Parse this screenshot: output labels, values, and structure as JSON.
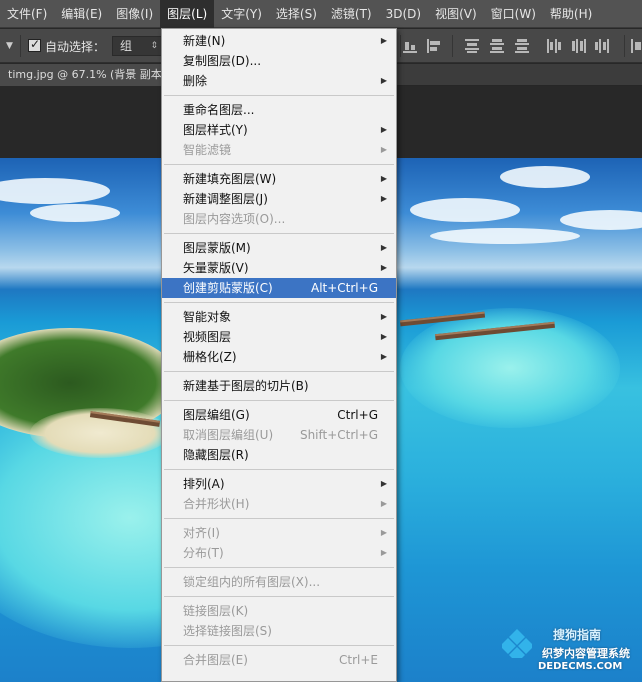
{
  "menubar": {
    "items": [
      "文件(F)",
      "编辑(E)",
      "图像(I)",
      "图层(L)",
      "文字(Y)",
      "选择(S)",
      "滤镜(T)",
      "3D(D)",
      "视图(V)",
      "窗口(W)",
      "帮助(H)"
    ],
    "active": "图层(L)"
  },
  "options": {
    "auto_select_label": "自动选择：",
    "auto_select_checked": true,
    "group_value": "组"
  },
  "document": {
    "tab_title": "timg.jpg @ 67.1% (背景 副本"
  },
  "layer_menu": {
    "items": [
      {
        "label": "新建(N)",
        "submenu": true
      },
      {
        "label": "复制图层(D)..."
      },
      {
        "label": "删除",
        "submenu": true
      },
      {
        "label": "重命名图层..."
      },
      {
        "label": "图层样式(Y)",
        "submenu": true
      },
      {
        "label": "智能滤镜",
        "submenu": true,
        "disabled": true
      },
      {
        "label": "新建填充图层(W)",
        "submenu": true
      },
      {
        "label": "新建调整图层(J)",
        "submenu": true
      },
      {
        "label": "图层内容选项(O)...",
        "disabled": true
      },
      {
        "label": "图层蒙版(M)",
        "submenu": true
      },
      {
        "label": "矢量蒙版(V)",
        "submenu": true
      },
      {
        "label": "创建剪贴蒙版(C)",
        "shortcut": "Alt+Ctrl+G",
        "highlighted": true
      },
      {
        "label": "智能对象",
        "submenu": true
      },
      {
        "label": "视频图层",
        "submenu": true
      },
      {
        "label": "栅格化(Z)",
        "submenu": true
      },
      {
        "label": "新建基于图层的切片(B)"
      },
      {
        "label": "图层编组(G)",
        "shortcut": "Ctrl+G"
      },
      {
        "label": "取消图层编组(U)",
        "shortcut": "Shift+Ctrl+G",
        "disabled": true
      },
      {
        "label": "隐藏图层(R)"
      },
      {
        "label": "排列(A)",
        "submenu": true
      },
      {
        "label": "合并形状(H)",
        "submenu": true,
        "disabled": true
      },
      {
        "label": "对齐(I)",
        "submenu": true,
        "disabled": true
      },
      {
        "label": "分布(T)",
        "submenu": true,
        "disabled": true
      },
      {
        "label": "锁定组内的所有图层(X)...",
        "disabled": true
      },
      {
        "label": "链接图层(K)",
        "disabled": true
      },
      {
        "label": "选择链接图层(S)",
        "disabled": true
      },
      {
        "label": "合并图层(E)",
        "shortcut": "Ctrl+E",
        "disabled": true
      }
    ]
  },
  "watermark": {
    "line1": "搜狗指南",
    "line2": "织梦内容管理系统",
    "line3": "DEDECMS.COM"
  },
  "colors": {
    "menu_highlight": "#3c74c4",
    "menu_bg": "#f1f1f1",
    "toolbar_bg": "#535353",
    "canvas_bg": "#282828"
  }
}
